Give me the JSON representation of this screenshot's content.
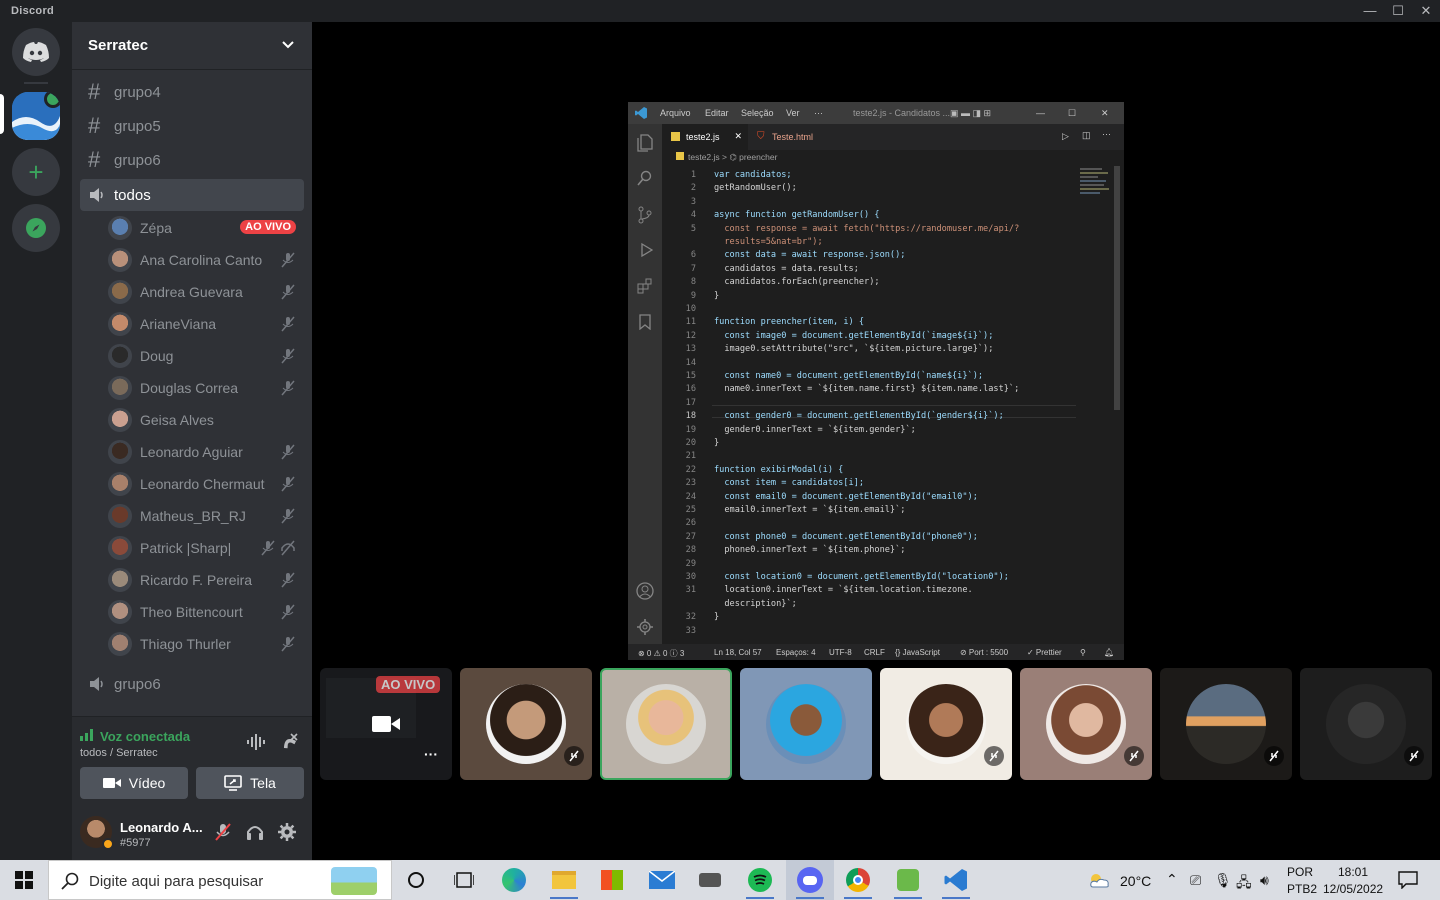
{
  "window": {
    "app_title": "Discord",
    "minimize": "—",
    "maximize": "☐",
    "close": "✕"
  },
  "server": {
    "name": "Serratec"
  },
  "channels": {
    "text": [
      {
        "label": "grupo4"
      },
      {
        "label": "grupo5"
      },
      {
        "label": "grupo6"
      }
    ],
    "voice_active": "todos",
    "voice_other": "grupo6"
  },
  "voice_users": [
    {
      "name": "Zépa",
      "live": "AO VIVO"
    },
    {
      "name": "Ana Carolina Canto"
    },
    {
      "name": "Andrea Guevara"
    },
    {
      "name": "ArianeViana"
    },
    {
      "name": "Doug"
    },
    {
      "name": "Douglas Correa"
    },
    {
      "name": "Geisa Alves"
    },
    {
      "name": "Leonardo Aguiar"
    },
    {
      "name": "Leonardo Chermaut"
    },
    {
      "name": "Matheus_BR_RJ"
    },
    {
      "name": "Patrick |Sharp|"
    },
    {
      "name": "Ricardo F. Pereira"
    },
    {
      "name": "Theo Bittencourt"
    },
    {
      "name": "Thiago Thurler"
    }
  ],
  "voice_panel": {
    "status": "Voz conectada",
    "location": "todos / Serratec",
    "video_label": "Vídeo",
    "screen_label": "Tela"
  },
  "user_panel": {
    "username": "Leonardo A...",
    "tag": "#5977"
  },
  "stream_tile": {
    "live": "AO VIVO",
    "more": "···"
  },
  "vscode": {
    "menu": [
      "Arquivo",
      "Editar",
      "Seleção",
      "Ver",
      "···"
    ],
    "title": "teste2.js - Candidatos ...",
    "tabs": [
      "teste2.js",
      "Teste.html"
    ],
    "breadcrumb": "teste2.js > ⌬ preencher",
    "lines": [
      {
        "n": "1",
        "t": "var candidatos;"
      },
      {
        "n": "2",
        "t": "getRandomUser();"
      },
      {
        "n": "3",
        "t": ""
      },
      {
        "n": "4",
        "t": "async function getRandomUser() {"
      },
      {
        "n": "5",
        "t": "  const response = await fetch(\"https://randomuser.me/api/?"
      },
      {
        "n": "",
        "t": "  results=5&nat=br\");"
      },
      {
        "n": "6",
        "t": "  const data = await response.json();"
      },
      {
        "n": "7",
        "t": "  candidatos = data.results;"
      },
      {
        "n": "8",
        "t": "  candidatos.forEach(preencher);"
      },
      {
        "n": "9",
        "t": "}"
      },
      {
        "n": "10",
        "t": ""
      },
      {
        "n": "11",
        "t": "function preencher(item, i) {"
      },
      {
        "n": "12",
        "t": "  const image0 = document.getElementById(`image${i}`);"
      },
      {
        "n": "13",
        "t": "  image0.setAttribute(\"src\", `${item.picture.large}`);"
      },
      {
        "n": "14",
        "t": ""
      },
      {
        "n": "15",
        "t": "  const name0 = document.getElementById(`name${i}`);"
      },
      {
        "n": "16",
        "t": "  name0.innerText = `${item.name.first} ${item.name.last}`;"
      },
      {
        "n": "17",
        "t": ""
      },
      {
        "n": "18",
        "t": "  const gender0 = document.getElementById(`gender${i}`);"
      },
      {
        "n": "19",
        "t": "  gender0.innerText = `${item.gender}`;"
      },
      {
        "n": "20",
        "t": "}"
      },
      {
        "n": "21",
        "t": ""
      },
      {
        "n": "22",
        "t": "function exibirModal(i) {"
      },
      {
        "n": "23",
        "t": "  const item = candidatos[i];"
      },
      {
        "n": "24",
        "t": "  const email0 = document.getElementById(\"email0\");"
      },
      {
        "n": "25",
        "t": "  email0.innerText = `${item.email}`;"
      },
      {
        "n": "26",
        "t": ""
      },
      {
        "n": "27",
        "t": "  const phone0 = document.getElementById(\"phone0\");"
      },
      {
        "n": "28",
        "t": "  phone0.innerText = `${item.phone}`;"
      },
      {
        "n": "29",
        "t": ""
      },
      {
        "n": "30",
        "t": "  const location0 = document.getElementById(\"location0\");"
      },
      {
        "n": "31",
        "t": "  location0.innerText = `${item.location.timezone."
      },
      {
        "n": "",
        "t": "  description}`;"
      },
      {
        "n": "32",
        "t": "}"
      },
      {
        "n": "33",
        "t": ""
      }
    ],
    "current_line": "18",
    "status": {
      "problems": "⊗ 0 ⚠ 0 ⓘ 3",
      "position": "Ln 18, Col 57",
      "spaces": "Espaços: 4",
      "encoding": "UTF-8",
      "eol": "CRLF",
      "language": "{} JavaScript",
      "port": "⊘ Port : 5500",
      "prettier": "✓ Prettier"
    }
  },
  "taskbar": {
    "search_placeholder": "Digite aqui para pesquisar",
    "weather": "20°C",
    "lang": "POR",
    "layout": "PTB2",
    "time": "18:01",
    "date": "12/05/2022"
  },
  "colors": {
    "accent": "#5865f2",
    "green": "#3ba55d",
    "live_red": "#ed4245"
  }
}
